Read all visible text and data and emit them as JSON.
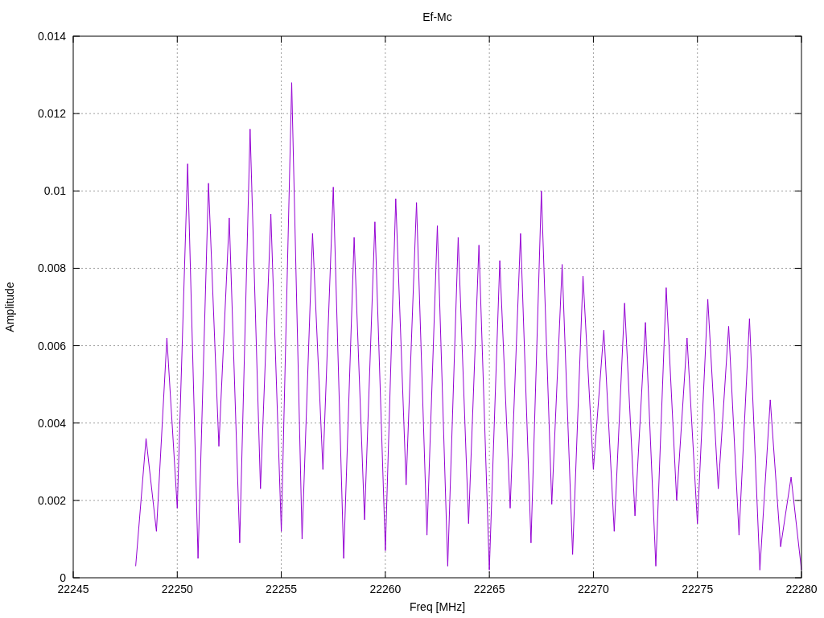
{
  "chart": {
    "chart_data": {
      "type": "line",
      "title": "Ef-Mc",
      "xlabel": "Freq [MHz]",
      "ylabel": "Amplitude",
      "xlim": [
        22245,
        22280
      ],
      "ylim": [
        0,
        0.014
      ],
      "xticks": [
        22245,
        22250,
        22255,
        22260,
        22265,
        22270,
        22275,
        22280
      ],
      "yticks": [
        0,
        0.002,
        0.004,
        0.006,
        0.008,
        0.01,
        0.012,
        0.014
      ],
      "grid": true,
      "x": [
        22248,
        22248.5,
        22249,
        22249.5,
        22250,
        22250.5,
        22251,
        22251.5,
        22252,
        22252.5,
        22253,
        22253.5,
        22254,
        22254.5,
        22255,
        22255.5,
        22256,
        22256.5,
        22257,
        22257.5,
        22258,
        22258.5,
        22259,
        22259.5,
        22260,
        22260.5,
        22261,
        22261.5,
        22262,
        22262.5,
        22263,
        22263.5,
        22264,
        22264.5,
        22265,
        22265.5,
        22266,
        22266.5,
        22267,
        22267.5,
        22268,
        22268.5,
        22269,
        22269.5,
        22270,
        22270.5,
        22271,
        22271.5,
        22272,
        22272.5,
        22273,
        22273.5,
        22274,
        22274.5,
        22275,
        22275.5,
        22276,
        22276.5,
        22277,
        22277.5,
        22278,
        22278.5,
        22279,
        22279.5,
        22280
      ],
      "series": [
        {
          "color": "#9400d3",
          "values": [
            0.0003,
            0.0036,
            0.0012,
            0.0062,
            0.0018,
            0.0107,
            0.0005,
            0.0102,
            0.0034,
            0.0093,
            0.0009,
            0.0116,
            0.0023,
            0.0094,
            0.0012,
            0.0128,
            0.001,
            0.0089,
            0.0028,
            0.0101,
            0.0005,
            0.0088,
            0.0015,
            0.0092,
            0.0007,
            0.0098,
            0.0024,
            0.0097,
            0.0011,
            0.0091,
            0.0003,
            0.0088,
            0.0014,
            0.0086,
            0.0002,
            0.0082,
            0.0018,
            0.0089,
            0.0009,
            0.01,
            0.0019,
            0.0081,
            0.0006,
            0.0078,
            0.0028,
            0.0064,
            0.0012,
            0.0071,
            0.0016,
            0.0066,
            0.0003,
            0.0075,
            0.002,
            0.0062,
            0.0014,
            0.0072,
            0.0023,
            0.0065,
            0.0011,
            0.0067,
            0.0002,
            0.0046,
            0.0008,
            0.0026,
            0.0002
          ]
        }
      ]
    }
  }
}
